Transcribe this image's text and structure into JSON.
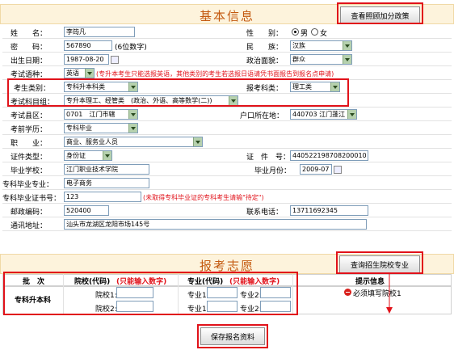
{
  "basic": {
    "title": "基本信息",
    "policy_button": "查看照顾加分政策",
    "fields": {
      "name_label": "姓　　名：",
      "name_value": "李筠凡",
      "gender_label": "性　　别：",
      "gender_male": "男",
      "gender_female": "女",
      "password_label": "密　　码：",
      "password_value": "567890",
      "password_hint": "(6位数字)",
      "ethnic_label": "民　　族：",
      "ethnic_value": "汉族",
      "birth_label": "出生日期：",
      "birth_value": "1987-08-20",
      "politic_label": "政治面貌：",
      "politic_value": "群众",
      "lang_label": "考试语种：",
      "lang_value": "英语",
      "lang_note": "(专升本考生只能选报英语，其他类别的考生若选报日语请凭书面报告到报名点申请)",
      "category_label": "考生类别：",
      "category_value": "专科升本科类",
      "subject_label": "报考科类：",
      "subject_value": "理工类",
      "group_label": "考试科目组：",
      "group_value": "专升本理工、经管类　(政治、外语、高等数学(二))",
      "county_label": "考试县区：",
      "county_value": "0701　江门市辖",
      "hukou_label": "户口所在地：",
      "hukou_value": "440703 江门蓬江",
      "edu_label": "考前学历：",
      "edu_value": "专科毕业",
      "job_label": "职　　业：",
      "job_value": "商业、服务业人员",
      "idtype_label": "证件类型：",
      "idtype_value": "身份证",
      "idno_label": "证　件　号：",
      "idno_value": "440522198708200010",
      "school_label": "毕业学校：",
      "school_value": "江门职业技术学院",
      "gradmonth_label": "毕业月份：",
      "gradmonth_value": "2009-07",
      "major_label": "专科毕业专业：",
      "major_value": "电子商务",
      "cert_label": "专科毕业证书号：",
      "cert_value": "123",
      "cert_note": "(未取得专科毕业证的专科考生请输\"待定\")",
      "postcode_label": "邮政编码：",
      "postcode_value": "520400",
      "phone_label": "联系电话：",
      "phone_value": "13711692345",
      "address_label": "通讯地址：",
      "address_value": "汕头市龙湖区龙阳市场145号"
    }
  },
  "apply": {
    "title": "报考志愿",
    "query_button": "查询招生院校专业",
    "col_batch": "批　次",
    "col_school": "院校(代码)",
    "col_school_note": "(只能输入数字)",
    "col_major": "专业(代码)",
    "col_major_note": "(只能输入数字)",
    "col_tip": "提示信息",
    "batch_name": "专科升本科",
    "school1": "院校1:",
    "school2": "院校2:",
    "major1": "专业1:",
    "major2": "专业2:",
    "major1b": "专业1:",
    "major2b": "专业2:",
    "tip_text": "必须填写院校1",
    "save_button": "保存报名资料"
  },
  "colors": {
    "accent": "#c45a10",
    "highlight": "#e1121a",
    "header_bg": "#fdf3dc"
  }
}
